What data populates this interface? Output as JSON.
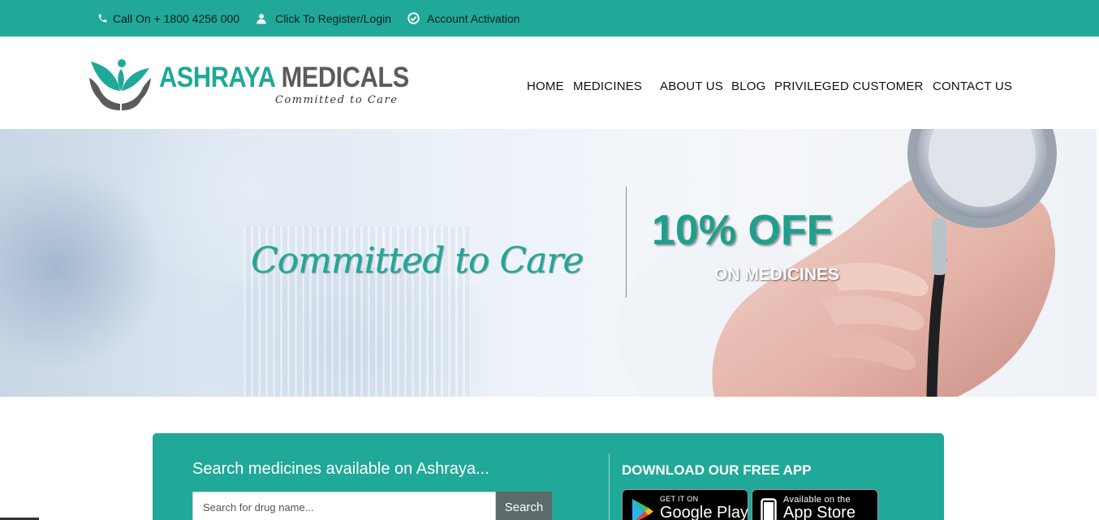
{
  "topbar": {
    "phone": {
      "label": "Call On + 1800 4256 000",
      "icon": "phone-icon"
    },
    "register": {
      "label": "Click To Register/Login",
      "icon": "user-icon"
    },
    "activation": {
      "label": "Account Activation",
      "icon": "check-circle-icon"
    }
  },
  "logo": {
    "name_part1": "ASHRAYA",
    "name_part2": "MEDICALS",
    "tagline": "Committed to Care",
    "icon": "leaf-hands-icon"
  },
  "nav": {
    "items": [
      "HOME",
      "MEDICINES",
      "ABOUT US",
      "BLOG",
      "PRIVILEGED CUSTOMER",
      "CONTACT US"
    ]
  },
  "hero": {
    "script": "Committed to Care",
    "offer": "10% OFF",
    "offer_sub": "ON MEDICINES",
    "image": "stethoscope-hand-icon"
  },
  "search": {
    "title": "Search medicines available on Ashraya...",
    "placeholder": "Search for drug name...",
    "button": "Search"
  },
  "download": {
    "title": "DOWNLOAD OUR FREE APP",
    "google": {
      "small": "GET IT ON",
      "big": "Google Play",
      "icon": "google-play-icon"
    },
    "apple": {
      "small": "Available on the",
      "big": "App Store",
      "icon": "phone-device-icon"
    }
  },
  "colors": {
    "brand": "#20a898",
    "logo_grey": "#5b5b5b",
    "search_button": "#5c6b6a"
  }
}
